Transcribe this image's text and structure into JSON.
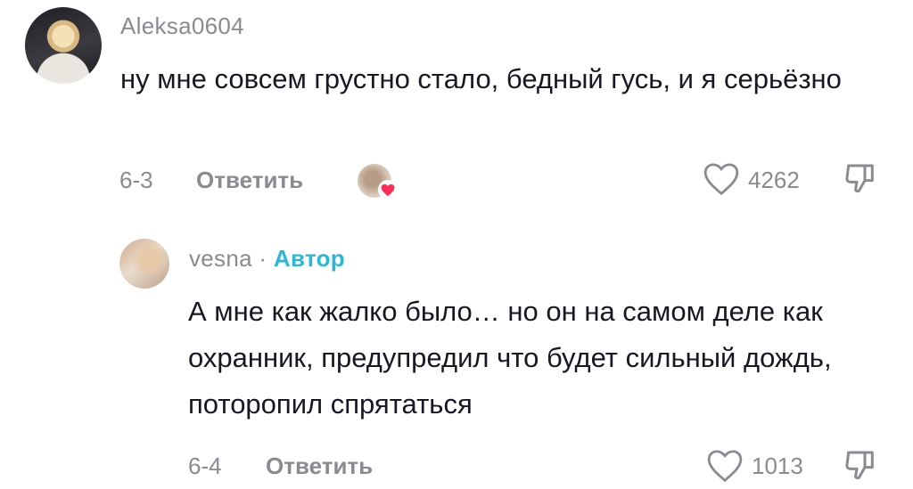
{
  "comments": [
    {
      "username": "Aleksa0604",
      "text": "ну мне совсем грустно стало, бедный гусь, и я серьёзно",
      "date": "6-3",
      "reply_label": "Ответить",
      "likes": "4262"
    },
    {
      "username": "vesna",
      "separator": "·",
      "badge": "Автор",
      "text": "А мне как жалко было… но он на самом деле как охранник, предупредил что будет сильный дождь, поторопил спрятаться",
      "date": "6-4",
      "reply_label": "Ответить",
      "likes": "1013"
    }
  ],
  "colors": {
    "author_badge": "#2bb7d8",
    "meta_gray": "#8a8b91",
    "text": "#161823",
    "heart_red": "#fe2c55"
  },
  "icons": [
    "heart-outline-icon",
    "dislike-icon",
    "liked-by-creator-heart-icon"
  ]
}
